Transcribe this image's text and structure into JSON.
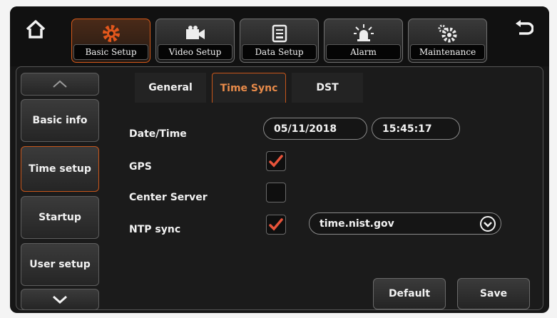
{
  "topbar": {
    "home_icon": "home-icon",
    "back_icon": "back-arrow-icon",
    "tabs": [
      {
        "label": "Basic Setup",
        "icon": "gear-icon",
        "active": true
      },
      {
        "label": "Video Setup",
        "icon": "video-camera-icon",
        "active": false
      },
      {
        "label": "Data Setup",
        "icon": "storage-icon",
        "active": false
      },
      {
        "label": "Alarm",
        "icon": "alarm-light-icon",
        "active": false
      },
      {
        "label": "Maintenance",
        "icon": "maintenance-gears-icon",
        "active": false
      }
    ]
  },
  "sidebar": {
    "up_icon": "chevron-up-icon",
    "down_icon": "chevron-down-icon",
    "items": [
      {
        "label": "Basic info",
        "active": false
      },
      {
        "label": "Time setup",
        "active": true
      },
      {
        "label": "Startup",
        "active": false
      },
      {
        "label": "User setup",
        "active": false
      }
    ]
  },
  "subtabs": [
    {
      "label": "General",
      "active": false
    },
    {
      "label": "Time Sync",
      "active": true
    },
    {
      "label": "DST",
      "active": false
    }
  ],
  "form": {
    "datetime_label": "Date/Time",
    "date_value": "05/11/2018",
    "time_value": "15:45:17",
    "gps_label": "GPS",
    "gps_checked": true,
    "center_server_label": "Center Server",
    "center_server_checked": false,
    "ntp_label": "NTP sync",
    "ntp_checked": true,
    "ntp_server": "time.nist.gov"
  },
  "buttons": {
    "default_label": "Default",
    "save_label": "Save"
  },
  "colors": {
    "accent": "#d65a1a",
    "check": "#e8533a"
  }
}
